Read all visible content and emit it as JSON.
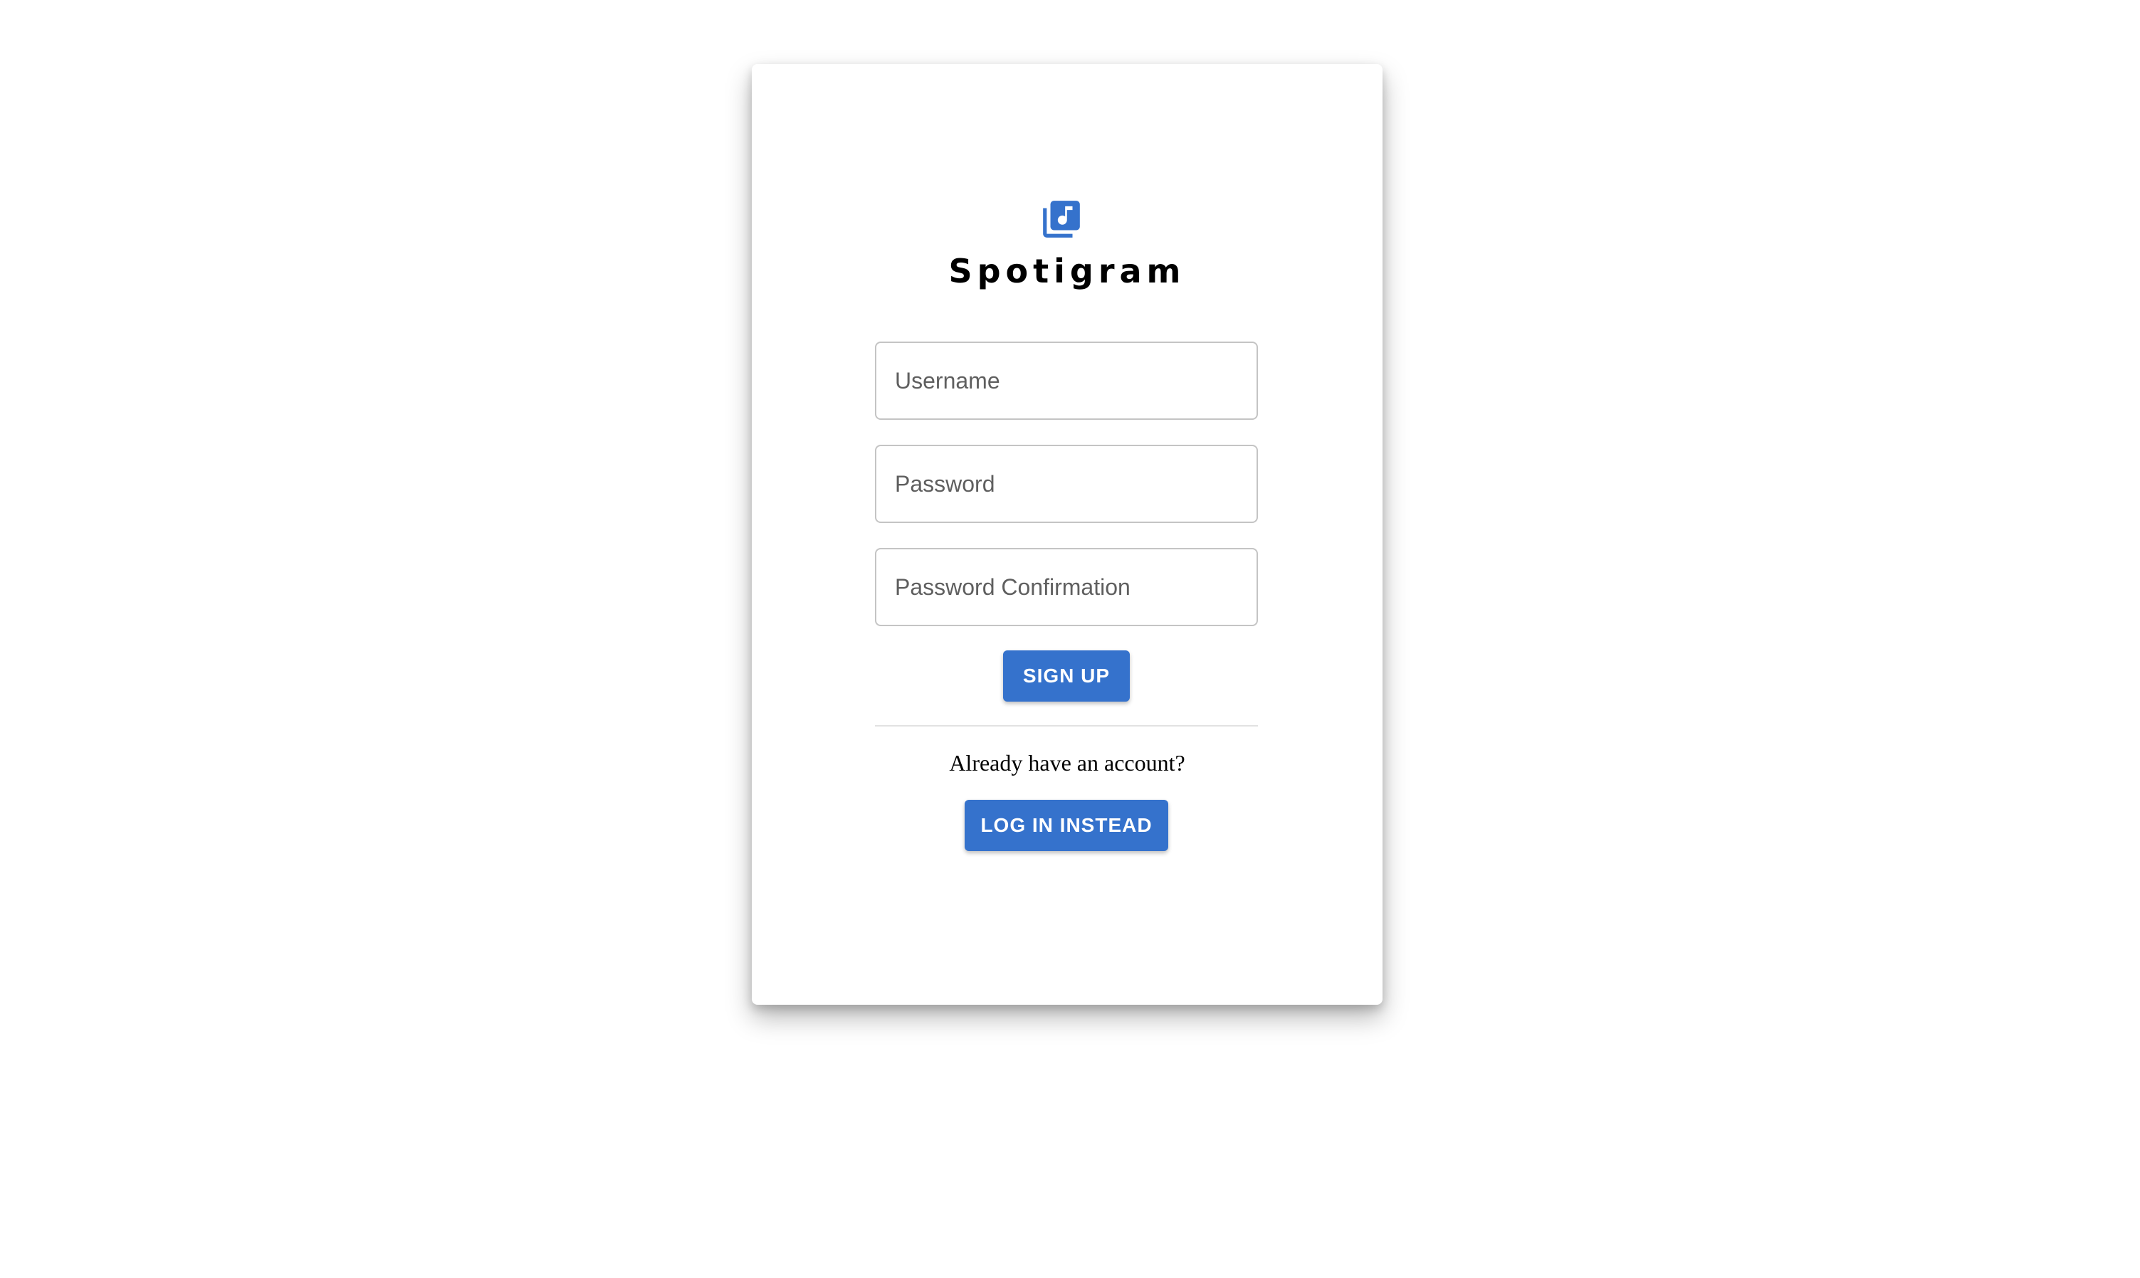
{
  "app": {
    "title": "Spotigram",
    "logo_icon": "music-library-icon",
    "accent_color": "#3572cc"
  },
  "signup_form": {
    "username": {
      "value": "",
      "placeholder": "Username"
    },
    "password": {
      "value": "",
      "placeholder": "Password"
    },
    "password_confirmation": {
      "value": "",
      "placeholder": "Password Confirmation"
    },
    "submit_label": "Sign up"
  },
  "login_prompt": {
    "text": "Already have an account?",
    "button_label": "Log in instead"
  }
}
